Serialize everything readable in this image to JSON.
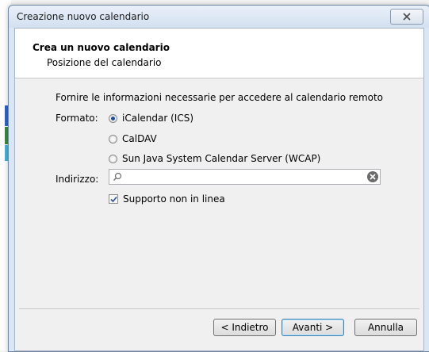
{
  "window": {
    "title": "Creazione nuovo calendario"
  },
  "header": {
    "title": "Crea un nuovo calendario",
    "subtitle": "Posizione del calendario"
  },
  "form": {
    "instruction": "Fornire le informazioni necessarie per accedere al calendario remoto",
    "format_label": "Formato:",
    "format_options": [
      {
        "label": "iCalendar (ICS)",
        "selected": true
      },
      {
        "label": "CalDAV",
        "selected": false
      },
      {
        "label": "Sun Java System Calendar Server (WCAP)",
        "selected": false
      }
    ],
    "address_label": "Indirizzo:",
    "address_value": "",
    "offline_label": "Supporto non in linea",
    "offline_checked": true
  },
  "buttons": {
    "back_label": "< Indietro",
    "next_label": "Avanti >",
    "cancel_label": "Annulla"
  },
  "icons": [
    "close-icon",
    "search-icon",
    "clear-icon",
    "checkmark-icon"
  ],
  "colors": {
    "accent": "#1f4f9a",
    "title_bar": "#dbe6f4"
  }
}
